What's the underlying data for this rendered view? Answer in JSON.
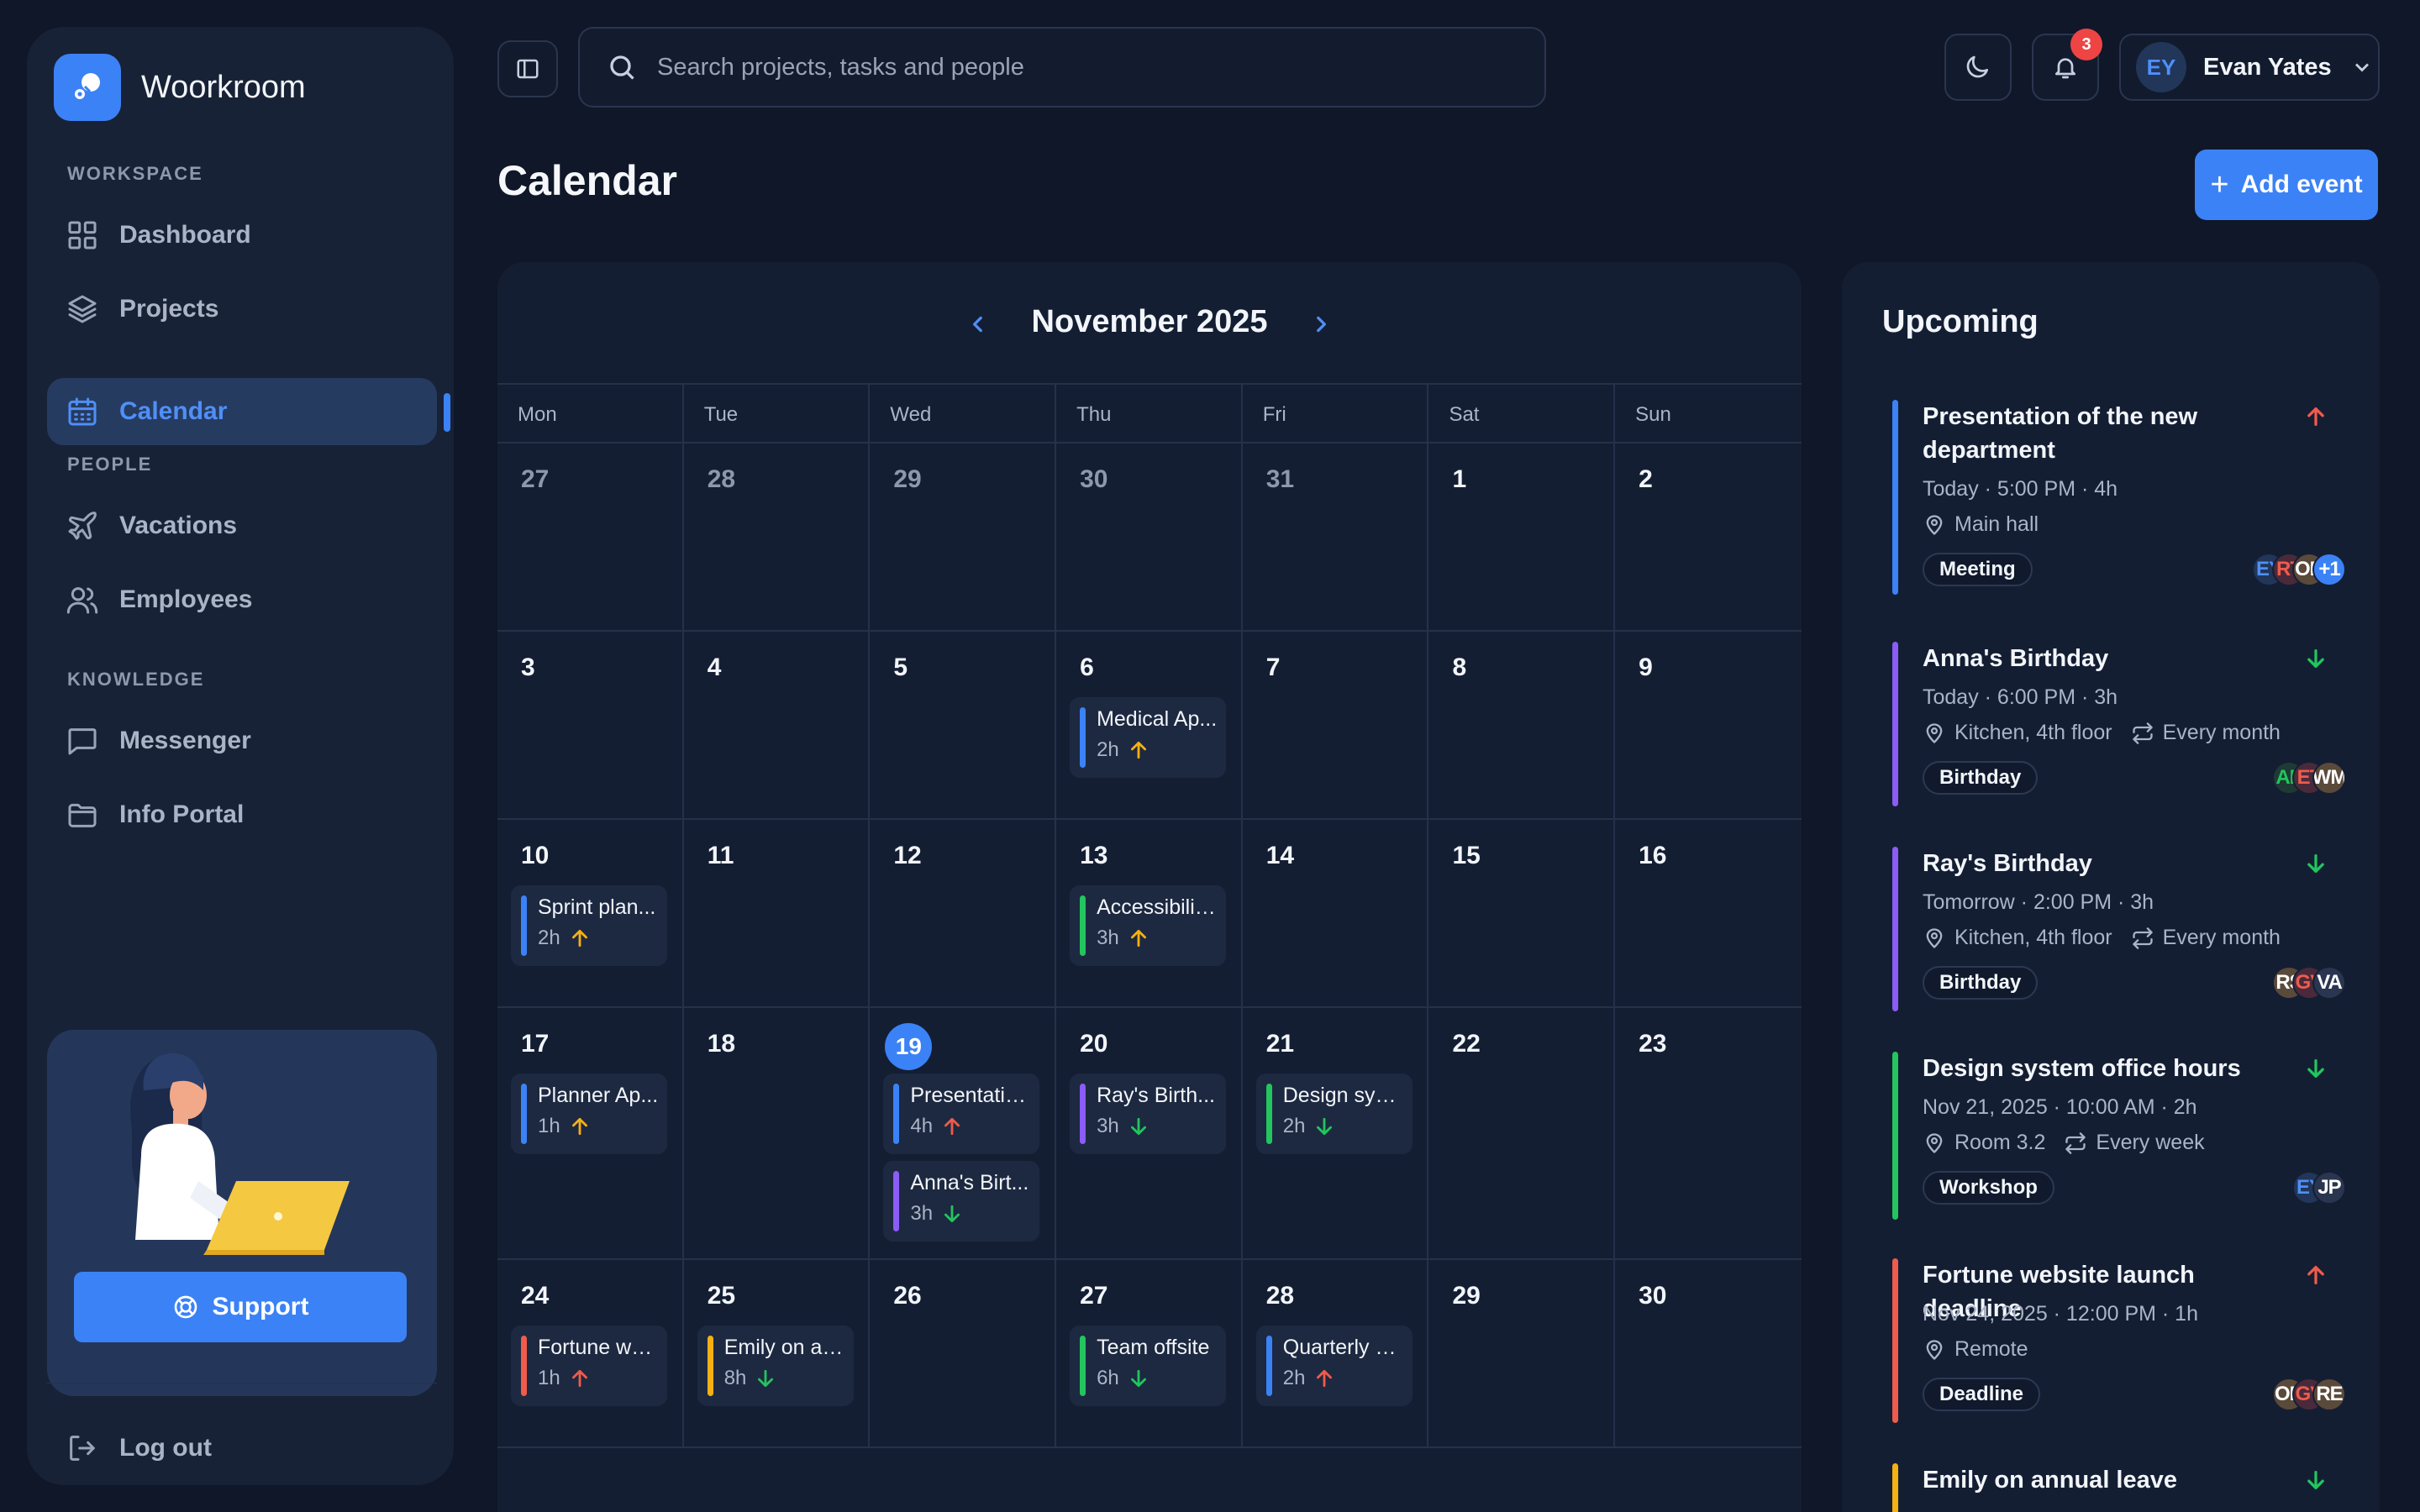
{
  "brand": {
    "name": "Woorkroom"
  },
  "sidebar": {
    "sections": {
      "workspace": "WORKSPACE",
      "people": "PEOPLE",
      "knowledge": "KNOWLEDGE"
    },
    "items": [
      {
        "label": "Dashboard",
        "icon": "dashboard-grid-icon"
      },
      {
        "label": "Projects",
        "icon": "layers-icon"
      },
      {
        "label": "Calendar",
        "icon": "calendar-icon",
        "active": true
      },
      {
        "label": "Vacations",
        "icon": "plane-icon"
      },
      {
        "label": "Employees",
        "icon": "users-icon"
      },
      {
        "label": "Messenger",
        "icon": "chat-icon"
      },
      {
        "label": "Info Portal",
        "icon": "folder-icon"
      }
    ],
    "support_label": "Support",
    "logout_label": "Log out"
  },
  "topbar": {
    "search_placeholder": "Search projects, tasks and people",
    "notification_count": "3",
    "user": {
      "initials": "EY",
      "name": "Evan Yates"
    }
  },
  "page": {
    "title": "Calendar",
    "add_event_label": "Add event"
  },
  "calendar": {
    "month_label": "November 2025",
    "weekdays": [
      "Mon",
      "Tue",
      "Wed",
      "Thu",
      "Fri",
      "Sat",
      "Sun"
    ],
    "weeks": [
      [
        {
          "n": "27",
          "muted": true
        },
        {
          "n": "28",
          "muted": true
        },
        {
          "n": "29",
          "muted": true
        },
        {
          "n": "30",
          "muted": true
        },
        {
          "n": "31",
          "muted": true
        },
        {
          "n": "1"
        },
        {
          "n": "2"
        }
      ],
      [
        {
          "n": "3"
        },
        {
          "n": "4"
        },
        {
          "n": "5"
        },
        {
          "n": "6",
          "events": [
            {
              "title": "Medical Ap...",
              "dur": "2h",
              "color": "#3b82f6",
              "prio": "up",
              "pcolor": "#f5b014"
            }
          ]
        },
        {
          "n": "7"
        },
        {
          "n": "8"
        },
        {
          "n": "9"
        }
      ],
      [
        {
          "n": "10",
          "events": [
            {
              "title": "Sprint plan...",
              "dur": "2h",
              "color": "#3b82f6",
              "prio": "up",
              "pcolor": "#f5b014"
            }
          ]
        },
        {
          "n": "11"
        },
        {
          "n": "12"
        },
        {
          "n": "13",
          "events": [
            {
              "title": "Accessibilit...",
              "dur": "3h",
              "color": "#22c55e",
              "prio": "up",
              "pcolor": "#f5b014"
            }
          ]
        },
        {
          "n": "14"
        },
        {
          "n": "15"
        },
        {
          "n": "16"
        }
      ],
      [
        {
          "n": "17",
          "events": [
            {
              "title": "Planner Ap...",
              "dur": "1h",
              "color": "#3b82f6",
              "prio": "up",
              "pcolor": "#f5b014"
            }
          ]
        },
        {
          "n": "18"
        },
        {
          "n": "19",
          "today": true,
          "events": [
            {
              "title": "Presentatio...",
              "dur": "4h",
              "color": "#3b82f6",
              "prio": "up",
              "pcolor": "#ef5b4c"
            },
            {
              "title": "Anna's Birt...",
              "dur": "3h",
              "color": "#8b5cf6",
              "prio": "down",
              "pcolor": "#22c55e"
            }
          ]
        },
        {
          "n": "20",
          "events": [
            {
              "title": "Ray's Birth...",
              "dur": "3h",
              "color": "#8b5cf6",
              "prio": "down",
              "pcolor": "#22c55e"
            }
          ]
        },
        {
          "n": "21",
          "events": [
            {
              "title": "Design syst...",
              "dur": "2h",
              "color": "#22c55e",
              "prio": "down",
              "pcolor": "#22c55e"
            }
          ]
        },
        {
          "n": "22"
        },
        {
          "n": "23"
        }
      ],
      [
        {
          "n": "24",
          "events": [
            {
              "title": "Fortune we...",
              "dur": "1h",
              "color": "#ef5b4c",
              "prio": "up",
              "pcolor": "#ef5b4c"
            }
          ]
        },
        {
          "n": "25",
          "events": [
            {
              "title": "Emily on an...",
              "dur": "8h",
              "color": "#f5b014",
              "prio": "down",
              "pcolor": "#22c55e"
            }
          ]
        },
        {
          "n": "26"
        },
        {
          "n": "27",
          "events": [
            {
              "title": "Team offsite",
              "dur": "6h",
              "color": "#22c55e",
              "prio": "down",
              "pcolor": "#22c55e"
            }
          ]
        },
        {
          "n": "28",
          "events": [
            {
              "title": "Quarterly a...",
              "dur": "2h",
              "color": "#3b82f6",
              "prio": "up",
              "pcolor": "#ef5b4c"
            }
          ]
        },
        {
          "n": "29"
        },
        {
          "n": "30"
        }
      ]
    ]
  },
  "upcoming": {
    "title": "Upcoming",
    "items": [
      {
        "title": "Presentation of the new department",
        "when": "Today · 5:00 PM · 4h",
        "location": "Main hall",
        "repeat": "",
        "tag": "Meeting",
        "color": "#3b82f6",
        "prio": "up",
        "pcolor": "#ef5b4c",
        "avatars": [
          {
            "i": "EY",
            "bg": "#213659",
            "fg": "#4f8ff7"
          },
          {
            "i": "RT",
            "bg": "#4a2a3a",
            "fg": "#ef5b4c"
          },
          {
            "i": "OD",
            "bg": "#5a4a3a",
            "fg": "#ffffff"
          },
          {
            "i": "+1",
            "bg": "#3b82f6",
            "fg": "#ffffff"
          }
        ]
      },
      {
        "title": "Anna's Birthday",
        "when": "Today · 6:00 PM · 3h",
        "location": "Kitchen, 4th floor",
        "repeat": "Every month",
        "tag": "Birthday",
        "color": "#8b5cf6",
        "prio": "down",
        "pcolor": "#22c55e",
        "avatars": [
          {
            "i": "AP",
            "bg": "#1f3a34",
            "fg": "#22c55e"
          },
          {
            "i": "ET",
            "bg": "#4a2a3a",
            "fg": "#ef5b4c"
          },
          {
            "i": "WM",
            "bg": "#5a4a3a",
            "fg": "#ffffff"
          }
        ]
      },
      {
        "title": "Ray's Birthday",
        "when": "Tomorrow · 2:00 PM · 3h",
        "location": "Kitchen, 4th floor",
        "repeat": "Every month",
        "tag": "Birthday",
        "color": "#8b5cf6",
        "prio": "down",
        "pcolor": "#22c55e",
        "avatars": [
          {
            "i": "RS",
            "bg": "#5a4a3a",
            "fg": "#ffffff"
          },
          {
            "i": "GV",
            "bg": "#4a2a3a",
            "fg": "#ef5b4c"
          },
          {
            "i": "VA",
            "bg": "#2a3550",
            "fg": "#ffffff"
          }
        ]
      },
      {
        "title": "Design system office hours",
        "when": "Nov 21, 2025 · 10:00 AM · 2h",
        "location": "Room 3.2",
        "repeat": "Every week",
        "tag": "Workshop",
        "color": "#22c55e",
        "prio": "down",
        "pcolor": "#22c55e",
        "avatars": [
          {
            "i": "EY",
            "bg": "#213659",
            "fg": "#4f8ff7"
          },
          {
            "i": "JP",
            "bg": "#2a3550",
            "fg": "#ffffff"
          }
        ]
      },
      {
        "title": "Fortune website launch deadline",
        "when": "Nov 24, 2025 · 12:00 PM · 1h",
        "location": "Remote",
        "repeat": "",
        "tag": "Deadline",
        "color": "#ef5b4c",
        "prio": "up",
        "pcolor": "#ef5b4c",
        "avatars": [
          {
            "i": "OD",
            "bg": "#5a4a3a",
            "fg": "#ffffff"
          },
          {
            "i": "GV",
            "bg": "#4a2a3a",
            "fg": "#ef5b4c"
          },
          {
            "i": "RE",
            "bg": "#5a4a3a",
            "fg": "#ffffff"
          }
        ]
      },
      {
        "title": "Emily on annual leave",
        "when": "",
        "location": "",
        "repeat": "",
        "tag": "",
        "color": "#f5b014",
        "prio": "down",
        "pcolor": "#22c55e",
        "avatars": []
      }
    ]
  }
}
